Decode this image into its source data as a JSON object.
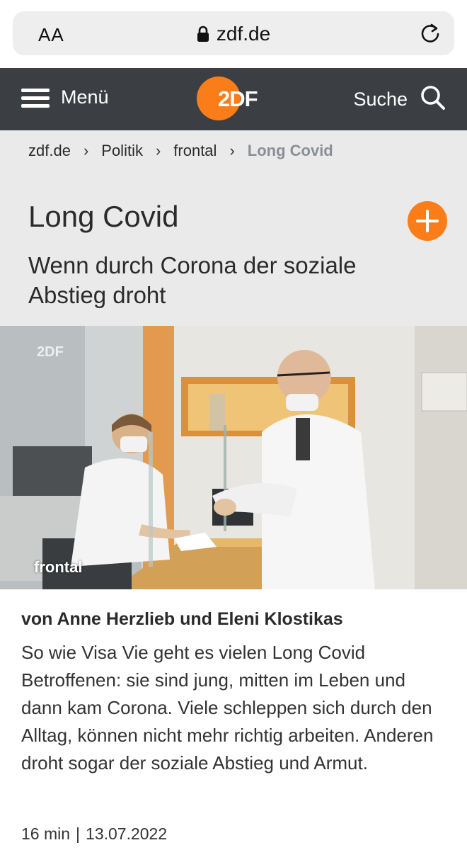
{
  "browser": {
    "text_size_label": "AA",
    "url": "zdf.de"
  },
  "header": {
    "menu_label": "Menü",
    "logo_text": "2DF",
    "search_label": "Suche"
  },
  "breadcrumb": [
    "zdf.de",
    "Politik",
    "frontal",
    "Long Covid"
  ],
  "article": {
    "title": "Long Covid",
    "subtitle": "Wenn durch Corona der soziale Abstieg droht",
    "video_watermark_logo": "2DF",
    "video_watermark_show": "frontal",
    "authors": "von Anne Herzlieb und Eleni Klostikas",
    "teaser": "So wie Visa Vie geht es vielen Long Covid Betroffenen: sie sind jung, mitten im Leben und dann kam Corona. Viele schleppen sich durch den Alltag, können nicht mehr richtig arbeiten. Anderen droht sogar der soziale Abstieg und Armut.",
    "duration": "16 min",
    "separator": "|",
    "date": "13.07.2022"
  },
  "colors": {
    "zdf_orange": "#fa7d19",
    "header_bg": "#3b3e42",
    "title_area_bg": "#eaeaea"
  },
  "icons": [
    "lock-icon",
    "reload-icon",
    "hamburger-icon",
    "search-icon",
    "plus-icon"
  ]
}
